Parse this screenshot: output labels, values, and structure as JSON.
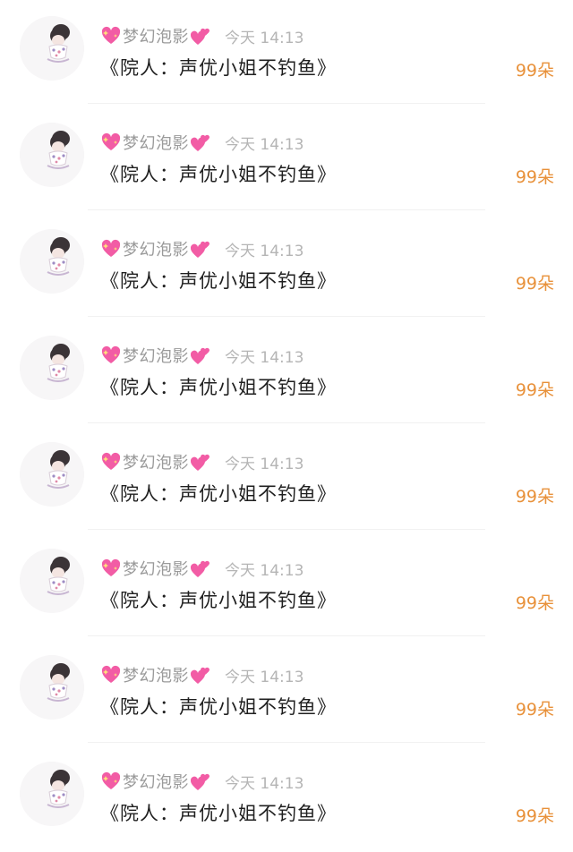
{
  "comments": [
    {
      "user": "梦幻泡影",
      "time": "今天 14:13",
      "text": "《院人：声优小姐不钓鱼》",
      "count": "99朵"
    },
    {
      "user": "梦幻泡影",
      "time": "今天 14:13",
      "text": "《院人：声优小姐不钓鱼》",
      "count": "99朵"
    },
    {
      "user": "梦幻泡影",
      "time": "今天 14:13",
      "text": "《院人：声优小姐不钓鱼》",
      "count": "99朵"
    },
    {
      "user": "梦幻泡影",
      "time": "今天 14:13",
      "text": "《院人：声优小姐不钓鱼》",
      "count": "99朵"
    },
    {
      "user": "梦幻泡影",
      "time": "今天 14:13",
      "text": "《院人：声优小姐不钓鱼》",
      "count": "99朵"
    },
    {
      "user": "梦幻泡影",
      "time": "今天 14:13",
      "text": "《院人：声优小姐不钓鱼》",
      "count": "99朵"
    },
    {
      "user": "梦幻泡影",
      "time": "今天 14:13",
      "text": "《院人：声优小姐不钓鱼》",
      "count": "99朵"
    },
    {
      "user": "梦幻泡影",
      "time": "今天 14:13",
      "text": "《院人：声优小姐不钓鱼》",
      "count": "99朵"
    }
  ],
  "icons": {
    "prefix_emoji": "sparkling-heart-icon",
    "suffix_emoji": "two-hearts-icon",
    "avatar": "avatar-illustration"
  },
  "colors": {
    "count": "#e8913a",
    "title": "#1f1f1f",
    "username": "#9a9a9a",
    "time": "#b5b5b5",
    "heart": "#f25ca5"
  }
}
